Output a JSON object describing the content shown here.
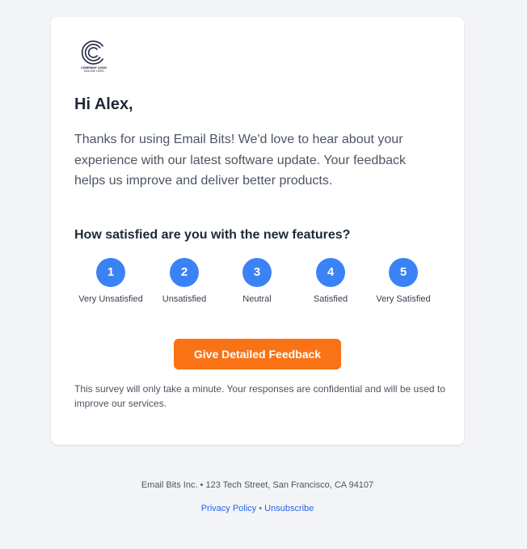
{
  "email": {
    "logo": {
      "name": "company-logo",
      "text_lines": [
        "COMPANY LOGO",
        "TAGLINE HERE"
      ]
    },
    "greeting": "Hi Alex,",
    "intro": "Thanks for using Email Bits! We'd love to hear about your experience with our latest software update. Your feedback helps us improve and deliver better products.",
    "question": "How satisfied are you with the new features?",
    "ratings": [
      {
        "value": "1",
        "label": "Very Unsatisfied"
      },
      {
        "value": "2",
        "label": "Unsatisfied"
      },
      {
        "value": "3",
        "label": "Neutral"
      },
      {
        "value": "4",
        "label": "Satisfied"
      },
      {
        "value": "5",
        "label": "Very Satisfied"
      }
    ],
    "cta_label": "Give Detailed Feedback",
    "note": "This survey will only take a minute. Your responses are confidential and will be used to improve our services."
  },
  "footer": {
    "address": "Email Bits Inc. • 123 Tech Street, San Francisco, CA 94107",
    "privacy_label": "Privacy Policy",
    "separator": "•",
    "unsubscribe_label": "Unsubscribe"
  },
  "colors": {
    "accent_blue": "#3b82f6",
    "cta_orange": "#f97316",
    "link_blue": "#2563eb",
    "background": "#f3f4f6"
  }
}
